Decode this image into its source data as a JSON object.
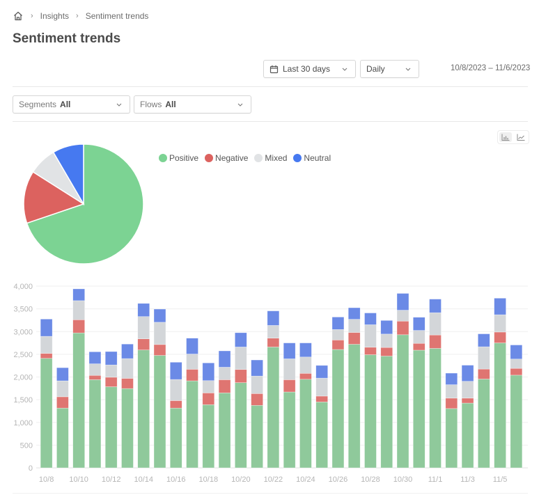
{
  "breadcrumb": {
    "home_icon": "home-icon",
    "separator": "›",
    "items": [
      "Insights",
      "Sentiment trends"
    ]
  },
  "page_title": "Sentiment trends",
  "controls": {
    "range_icon": "calendar-icon",
    "range_value": "Last 30 days",
    "granularity_value": "Daily",
    "date_range_text": "10/8/2023 – 11/6/2023"
  },
  "filters": [
    {
      "label": "Segments",
      "value": "All"
    },
    {
      "label": "Flows",
      "value": "All"
    }
  ],
  "view_toggle": {
    "options": [
      {
        "icon": "bar-chart-icon",
        "active": true
      },
      {
        "icon": "line-chart-icon",
        "active": false
      }
    ]
  },
  "colors": {
    "Positive": "#7cd393",
    "Negative": "#dc625f",
    "Mixed": "#e1e3e5",
    "Neutral": "#4679f0",
    "bar_Positive": "#8fc99b",
    "bar_Negative": "#df7571",
    "bar_Mixed": "#d3d6d9",
    "bar_Neutral": "#6b8ae6"
  },
  "chart_data": [
    {
      "type": "pie",
      "title": "",
      "categories": [
        "Positive",
        "Negative",
        "Mixed",
        "Neutral"
      ],
      "values": [
        69.8,
        14.2,
        7.6,
        8.4
      ],
      "unit": "percent",
      "start": "12 o'clock, clockwise",
      "legend": {
        "position": "right-top",
        "entries": [
          "Positive",
          "Negative",
          "Mixed",
          "Neutral"
        ]
      }
    },
    {
      "type": "bar",
      "stacked": true,
      "title": "",
      "xlabel": "",
      "ylabel": "",
      "ylim": [
        0,
        4000
      ],
      "yticks": [
        0,
        500,
        1000,
        1500,
        2000,
        2500,
        3000,
        3500,
        4000
      ],
      "ytick_labels": [
        "0",
        "500",
        "1,000",
        "1,500",
        "2,000",
        "2,500",
        "3,000",
        "3,500",
        "4,000"
      ],
      "grid": true,
      "categories": [
        "10/8",
        "10/9",
        "10/10",
        "10/11",
        "10/12",
        "10/13",
        "10/14",
        "10/15",
        "10/16",
        "10/17",
        "10/18",
        "10/19",
        "10/20",
        "10/21",
        "10/22",
        "10/23",
        "10/24",
        "10/25",
        "10/26",
        "10/27",
        "10/28",
        "10/29",
        "10/30",
        "10/31",
        "11/1",
        "11/2",
        "11/3",
        "11/4",
        "11/5",
        "11/6"
      ],
      "xtick_labels": [
        "10/8",
        "10/10",
        "10/12",
        "10/14",
        "10/16",
        "10/18",
        "10/20",
        "10/22",
        "10/24",
        "10/26",
        "10/28",
        "10/30",
        "11/1",
        "11/3",
        "11/5"
      ],
      "series": [
        {
          "name": "Positive",
          "values": [
            2410,
            1315,
            2970,
            1940,
            1785,
            1745,
            2595,
            2475,
            1315,
            1915,
            1390,
            1650,
            1875,
            1375,
            2660,
            1670,
            1950,
            1450,
            2605,
            2720,
            2490,
            2460,
            2930,
            2590,
            2630,
            1305,
            1425,
            1955,
            2750,
            2040
          ]
        },
        {
          "name": "Negative",
          "values": [
            110,
            250,
            290,
            95,
            210,
            225,
            245,
            240,
            165,
            255,
            260,
            290,
            290,
            260,
            195,
            270,
            130,
            130,
            210,
            260,
            165,
            190,
            300,
            150,
            295,
            230,
            110,
            220,
            240,
            150
          ]
        },
        {
          "name": "Mixed",
          "values": [
            375,
            350,
            420,
            255,
            270,
            435,
            490,
            490,
            465,
            335,
            270,
            275,
            495,
            385,
            280,
            460,
            360,
            395,
            230,
            290,
            495,
            295,
            240,
            285,
            490,
            295,
            370,
            490,
            380,
            205
          ]
        },
        {
          "name": "Neutral",
          "values": [
            380,
            290,
            260,
            265,
            295,
            320,
            290,
            290,
            380,
            350,
            390,
            360,
            315,
            355,
            320,
            350,
            310,
            280,
            275,
            255,
            260,
            300,
            370,
            290,
            300,
            255,
            355,
            285,
            365,
            310
          ]
        }
      ]
    }
  ]
}
